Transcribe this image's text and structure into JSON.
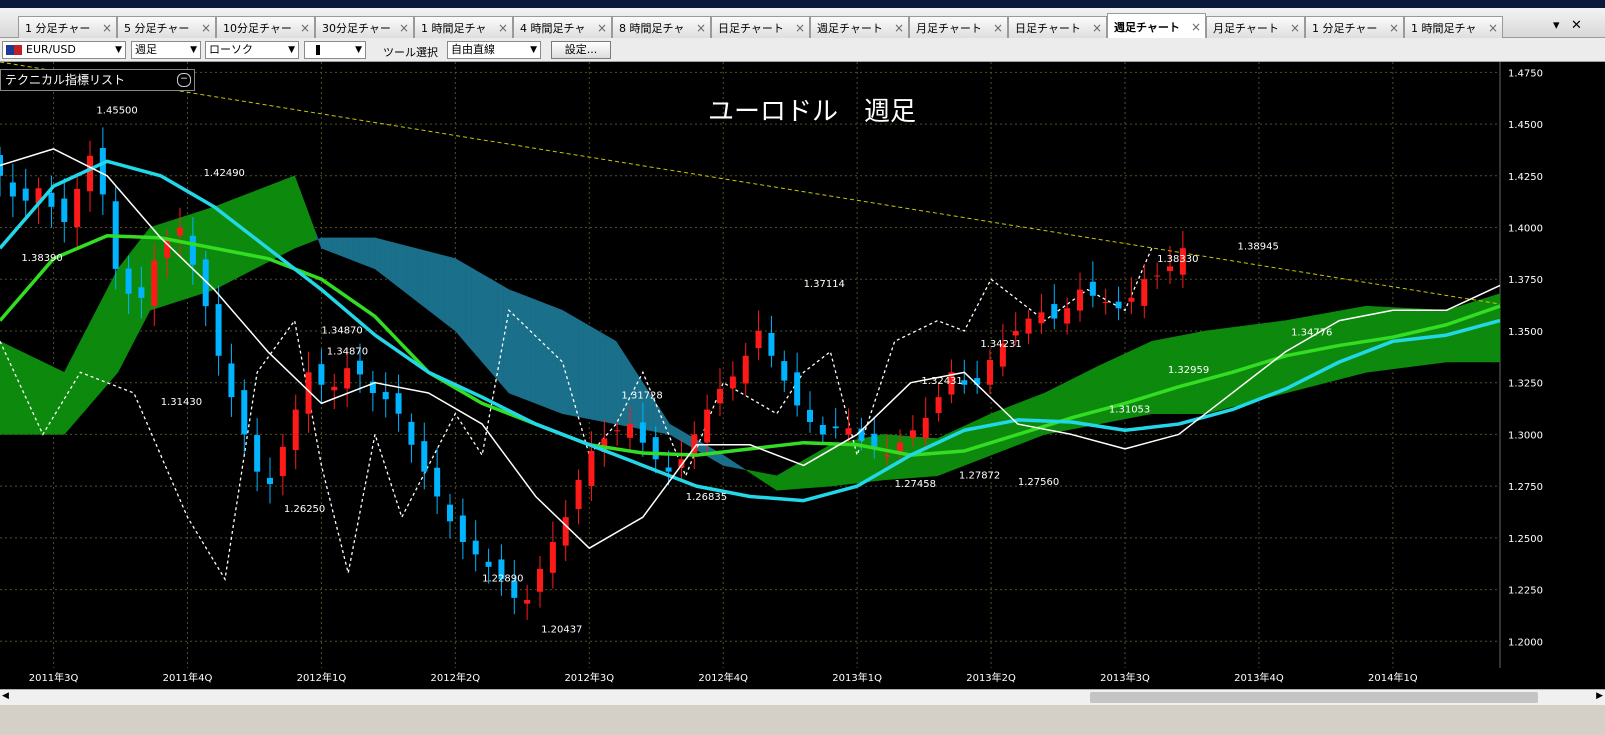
{
  "top_strip_text": "",
  "tabs": [
    {
      "label": "1 分足チャー"
    },
    {
      "label": "5 分足チャー"
    },
    {
      "label": "10分足チャー"
    },
    {
      "label": "30分足チャー"
    },
    {
      "label": "1 時間足チャ"
    },
    {
      "label": "4 時間足チャ"
    },
    {
      "label": "8 時間足チャ"
    },
    {
      "label": "日足チャート"
    },
    {
      "label": "週足チャート"
    },
    {
      "label": "月足チャート"
    },
    {
      "label": "日足チャート"
    },
    {
      "label": "週足チャート",
      "active": true
    },
    {
      "label": "月足チャート"
    },
    {
      "label": "1 分足チャー"
    },
    {
      "label": "1 時間足チャ"
    }
  ],
  "toolbar": {
    "symbol": "EUR/USD",
    "period": "週足",
    "chart_style": "ローソク",
    "tool_label": "ツール選択",
    "tool_value": "自由直線",
    "settings_label": "設定..."
  },
  "indicator_panel": {
    "label": "テクニカル指標リスト"
  },
  "chart_title": "ユーロドル　週足",
  "colors": {
    "up": "#ff1a1a",
    "down": "#00b4ff",
    "cloud_bull": "#0d8a0d",
    "cloud_bear": "#1a6f8a",
    "ma_long": "#33dd22",
    "ma_mid": "#22d8e8",
    "ma_short": "#ffffff",
    "trend_line": "#c8c800"
  },
  "chart_data": {
    "type": "candlestick",
    "title": "ユーロドル　週足",
    "ylim": [
      1.19,
      1.48
    ],
    "y_ticks": [
      1.475,
      1.45,
      1.425,
      1.4,
      1.375,
      1.35,
      1.325,
      1.3,
      1.275,
      1.25,
      1.225,
      1.2
    ],
    "x_ticks": [
      "2011年3Q",
      "2011年4Q",
      "2012年1Q",
      "2012年2Q",
      "2012年3Q",
      "2012年4Q",
      "2013年1Q",
      "2013年2Q",
      "2013年3Q",
      "2013年4Q",
      "2014年1Q"
    ],
    "grid": true,
    "ma_long_anchors": [
      [
        0,
        1.355
      ],
      [
        10,
        1.385
      ],
      [
        20,
        1.396
      ],
      [
        30,
        1.395
      ],
      [
        40,
        1.39
      ],
      [
        50,
        1.385
      ],
      [
        60,
        1.375
      ],
      [
        70,
        1.357
      ],
      [
        80,
        1.33
      ],
      [
        90,
        1.315
      ],
      [
        100,
        1.305
      ],
      [
        110,
        1.295
      ],
      [
        120,
        1.291
      ],
      [
        130,
        1.29
      ],
      [
        140,
        1.293
      ],
      [
        150,
        1.296
      ],
      [
        160,
        1.295
      ],
      [
        170,
        1.29
      ],
      [
        180,
        1.292
      ],
      [
        190,
        1.3
      ],
      [
        200,
        1.308
      ],
      [
        210,
        1.315
      ],
      [
        220,
        1.323
      ],
      [
        230,
        1.33
      ],
      [
        240,
        1.338
      ],
      [
        250,
        1.343
      ],
      [
        260,
        1.347
      ],
      [
        270,
        1.353
      ],
      [
        280,
        1.362
      ]
    ],
    "ma_mid_anchors": [
      [
        0,
        1.39
      ],
      [
        10,
        1.42
      ],
      [
        20,
        1.432
      ],
      [
        30,
        1.425
      ],
      [
        40,
        1.41
      ],
      [
        50,
        1.39
      ],
      [
        60,
        1.37
      ],
      [
        70,
        1.348
      ],
      [
        80,
        1.33
      ],
      [
        90,
        1.318
      ],
      [
        100,
        1.305
      ],
      [
        110,
        1.295
      ],
      [
        120,
        1.285
      ],
      [
        130,
        1.275
      ],
      [
        140,
        1.27
      ],
      [
        150,
        1.268
      ],
      [
        160,
        1.275
      ],
      [
        170,
        1.29
      ],
      [
        180,
        1.302
      ],
      [
        190,
        1.307
      ],
      [
        200,
        1.306
      ],
      [
        210,
        1.302
      ],
      [
        220,
        1.305
      ],
      [
        230,
        1.312
      ],
      [
        240,
        1.322
      ],
      [
        250,
        1.335
      ],
      [
        260,
        1.345
      ],
      [
        270,
        1.348
      ],
      [
        280,
        1.355
      ]
    ],
    "ma_short_anchors": [
      [
        0,
        1.43
      ],
      [
        10,
        1.438
      ],
      [
        20,
        1.425
      ],
      [
        30,
        1.395
      ],
      [
        40,
        1.37
      ],
      [
        50,
        1.34
      ],
      [
        60,
        1.315
      ],
      [
        70,
        1.325
      ],
      [
        80,
        1.32
      ],
      [
        90,
        1.305
      ],
      [
        100,
        1.27
      ],
      [
        110,
        1.245
      ],
      [
        120,
        1.26
      ],
      [
        130,
        1.295
      ],
      [
        140,
        1.295
      ],
      [
        150,
        1.285
      ],
      [
        160,
        1.3
      ],
      [
        170,
        1.325
      ],
      [
        180,
        1.33
      ],
      [
        190,
        1.305
      ],
      [
        200,
        1.3
      ],
      [
        210,
        1.293
      ],
      [
        220,
        1.3
      ],
      [
        230,
        1.32
      ],
      [
        240,
        1.34
      ],
      [
        250,
        1.355
      ],
      [
        260,
        1.36
      ],
      [
        270,
        1.36
      ],
      [
        280,
        1.372
      ]
    ],
    "chikou_anchors": [
      [
        0,
        1.345
      ],
      [
        8,
        1.3
      ],
      [
        15,
        1.33
      ],
      [
        25,
        1.32
      ],
      [
        35,
        1.26
      ],
      [
        42,
        1.23
      ],
      [
        48,
        1.33
      ],
      [
        55,
        1.355
      ],
      [
        60,
        1.285
      ],
      [
        65,
        1.233
      ],
      [
        70,
        1.3
      ],
      [
        75,
        1.26
      ],
      [
        85,
        1.31
      ],
      [
        90,
        1.29
      ],
      [
        95,
        1.36
      ],
      [
        105,
        1.335
      ],
      [
        110,
        1.29
      ],
      [
        115,
        1.305
      ],
      [
        120,
        1.33
      ],
      [
        128,
        1.28
      ],
      [
        135,
        1.325
      ],
      [
        145,
        1.31
      ],
      [
        150,
        1.33
      ],
      [
        155,
        1.34
      ],
      [
        160,
        1.29
      ],
      [
        167,
        1.345
      ],
      [
        175,
        1.355
      ],
      [
        180,
        1.35
      ],
      [
        185,
        1.375
      ],
      [
        195,
        1.355
      ],
      [
        203,
        1.37
      ],
      [
        210,
        1.36
      ],
      [
        215,
        1.39
      ]
    ],
    "candle_anchors": [
      [
        0,
        1.435
      ],
      [
        6,
        1.41
      ],
      [
        10,
        1.42
      ],
      [
        14,
        1.4
      ],
      [
        20,
        1.44
      ],
      [
        24,
        1.38
      ],
      [
        28,
        1.36
      ],
      [
        32,
        1.39
      ],
      [
        36,
        1.4
      ],
      [
        40,
        1.37
      ],
      [
        44,
        1.33
      ],
      [
        48,
        1.3
      ],
      [
        52,
        1.27
      ],
      [
        56,
        1.3
      ],
      [
        60,
        1.33
      ],
      [
        64,
        1.32
      ],
      [
        68,
        1.335
      ],
      [
        72,
        1.32
      ],
      [
        76,
        1.315
      ],
      [
        80,
        1.29
      ],
      [
        84,
        1.27
      ],
      [
        88,
        1.25
      ],
      [
        92,
        1.24
      ],
      [
        96,
        1.23
      ],
      [
        100,
        1.215
      ],
      [
        104,
        1.24
      ],
      [
        108,
        1.26
      ],
      [
        112,
        1.29
      ],
      [
        116,
        1.3
      ],
      [
        120,
        1.305
      ],
      [
        124,
        1.29
      ],
      [
        128,
        1.28
      ],
      [
        132,
        1.3
      ],
      [
        136,
        1.32
      ],
      [
        140,
        1.33
      ],
      [
        144,
        1.35
      ],
      [
        148,
        1.33
      ],
      [
        152,
        1.31
      ],
      [
        156,
        1.3
      ],
      [
        160,
        1.305
      ],
      [
        164,
        1.295
      ],
      [
        168,
        1.29
      ],
      [
        172,
        1.3
      ],
      [
        176,
        1.31
      ],
      [
        180,
        1.33
      ],
      [
        184,
        1.32
      ],
      [
        188,
        1.34
      ],
      [
        192,
        1.35
      ],
      [
        196,
        1.36
      ],
      [
        200,
        1.355
      ],
      [
        204,
        1.37
      ],
      [
        208,
        1.365
      ],
      [
        212,
        1.36
      ],
      [
        216,
        1.375
      ],
      [
        220,
        1.378
      ],
      [
        223,
        1.39
      ]
    ],
    "cloud_a_anchors": [
      [
        0,
        1.345
      ],
      [
        12,
        1.33
      ],
      [
        22,
        1.38
      ],
      [
        28,
        1.4
      ],
      [
        40,
        1.41
      ],
      [
        55,
        1.425
      ],
      [
        60,
        1.39
      ],
      [
        70,
        1.38
      ],
      [
        85,
        1.35
      ],
      [
        95,
        1.32
      ],
      [
        105,
        1.31
      ],
      [
        115,
        1.305
      ],
      [
        125,
        1.3
      ],
      [
        135,
        1.285
      ],
      [
        145,
        1.28
      ],
      [
        155,
        1.295
      ],
      [
        165,
        1.3
      ],
      [
        175,
        1.298
      ],
      [
        185,
        1.31
      ],
      [
        195,
        1.32
      ],
      [
        205,
        1.333
      ],
      [
        215,
        1.345
      ],
      [
        225,
        1.35
      ],
      [
        240,
        1.355
      ],
      [
        255,
        1.362
      ],
      [
        270,
        1.36
      ],
      [
        280,
        1.368
      ]
    ],
    "cloud_b_anchors": [
      [
        0,
        1.3
      ],
      [
        12,
        1.3
      ],
      [
        22,
        1.33
      ],
      [
        28,
        1.36
      ],
      [
        40,
        1.37
      ],
      [
        55,
        1.39
      ],
      [
        60,
        1.395
      ],
      [
        70,
        1.395
      ],
      [
        85,
        1.385
      ],
      [
        95,
        1.37
      ],
      [
        105,
        1.36
      ],
      [
        115,
        1.345
      ],
      [
        125,
        1.305
      ],
      [
        135,
        1.29
      ],
      [
        145,
        1.273
      ],
      [
        155,
        1.275
      ],
      [
        165,
        1.278
      ],
      [
        175,
        1.28
      ],
      [
        185,
        1.29
      ],
      [
        195,
        1.3
      ],
      [
        205,
        1.305
      ],
      [
        215,
        1.31
      ],
      [
        225,
        1.31
      ],
      [
        240,
        1.32
      ],
      [
        255,
        1.33
      ],
      [
        270,
        1.335
      ],
      [
        280,
        1.335
      ]
    ],
    "trend_line": [
      [
        0,
        1.48
      ],
      [
        280,
        1.363
      ]
    ],
    "annotations": [
      {
        "x": 18,
        "y": 1.455,
        "text": "1.45500"
      },
      {
        "x": 38,
        "y": 1.4249,
        "text": "1.42490"
      },
      {
        "x": 4,
        "y": 1.3839,
        "text": "1.38390"
      },
      {
        "x": 60,
        "y": 1.3487,
        "text": "1.34870"
      },
      {
        "x": 61,
        "y": 1.3387,
        "text": "1.34870"
      },
      {
        "x": 30,
        "y": 1.3143,
        "text": "1.31430"
      },
      {
        "x": 53,
        "y": 1.2625,
        "text": "1.26250"
      },
      {
        "x": 90,
        "y": 1.2289,
        "text": "1.22890"
      },
      {
        "x": 101,
        "y": 1.20437,
        "text": "1.20437"
      },
      {
        "x": 116,
        "y": 1.31728,
        "text": "1.31728"
      },
      {
        "x": 128,
        "y": 1.26835,
        "text": "1.26835"
      },
      {
        "x": 150,
        "y": 1.37114,
        "text": "1.37114"
      },
      {
        "x": 172,
        "y": 1.32431,
        "text": "1.32431"
      },
      {
        "x": 183,
        "y": 1.34231,
        "text": "1.34231"
      },
      {
        "x": 167,
        "y": 1.27458,
        "text": "1.27458"
      },
      {
        "x": 179,
        "y": 1.27872,
        "text": "1.27872"
      },
      {
        "x": 190,
        "y": 1.2756,
        "text": "1.27560"
      },
      {
        "x": 207,
        "y": 1.31053,
        "text": "1.31053"
      },
      {
        "x": 216,
        "y": 1.3833,
        "text": "1.38330"
      },
      {
        "x": 231,
        "y": 1.38945,
        "text": "1.38945"
      },
      {
        "x": 218,
        "y": 1.32959,
        "text": "1.32959"
      },
      {
        "x": 241,
        "y": 1.34776,
        "text": "1.34776"
      }
    ]
  }
}
